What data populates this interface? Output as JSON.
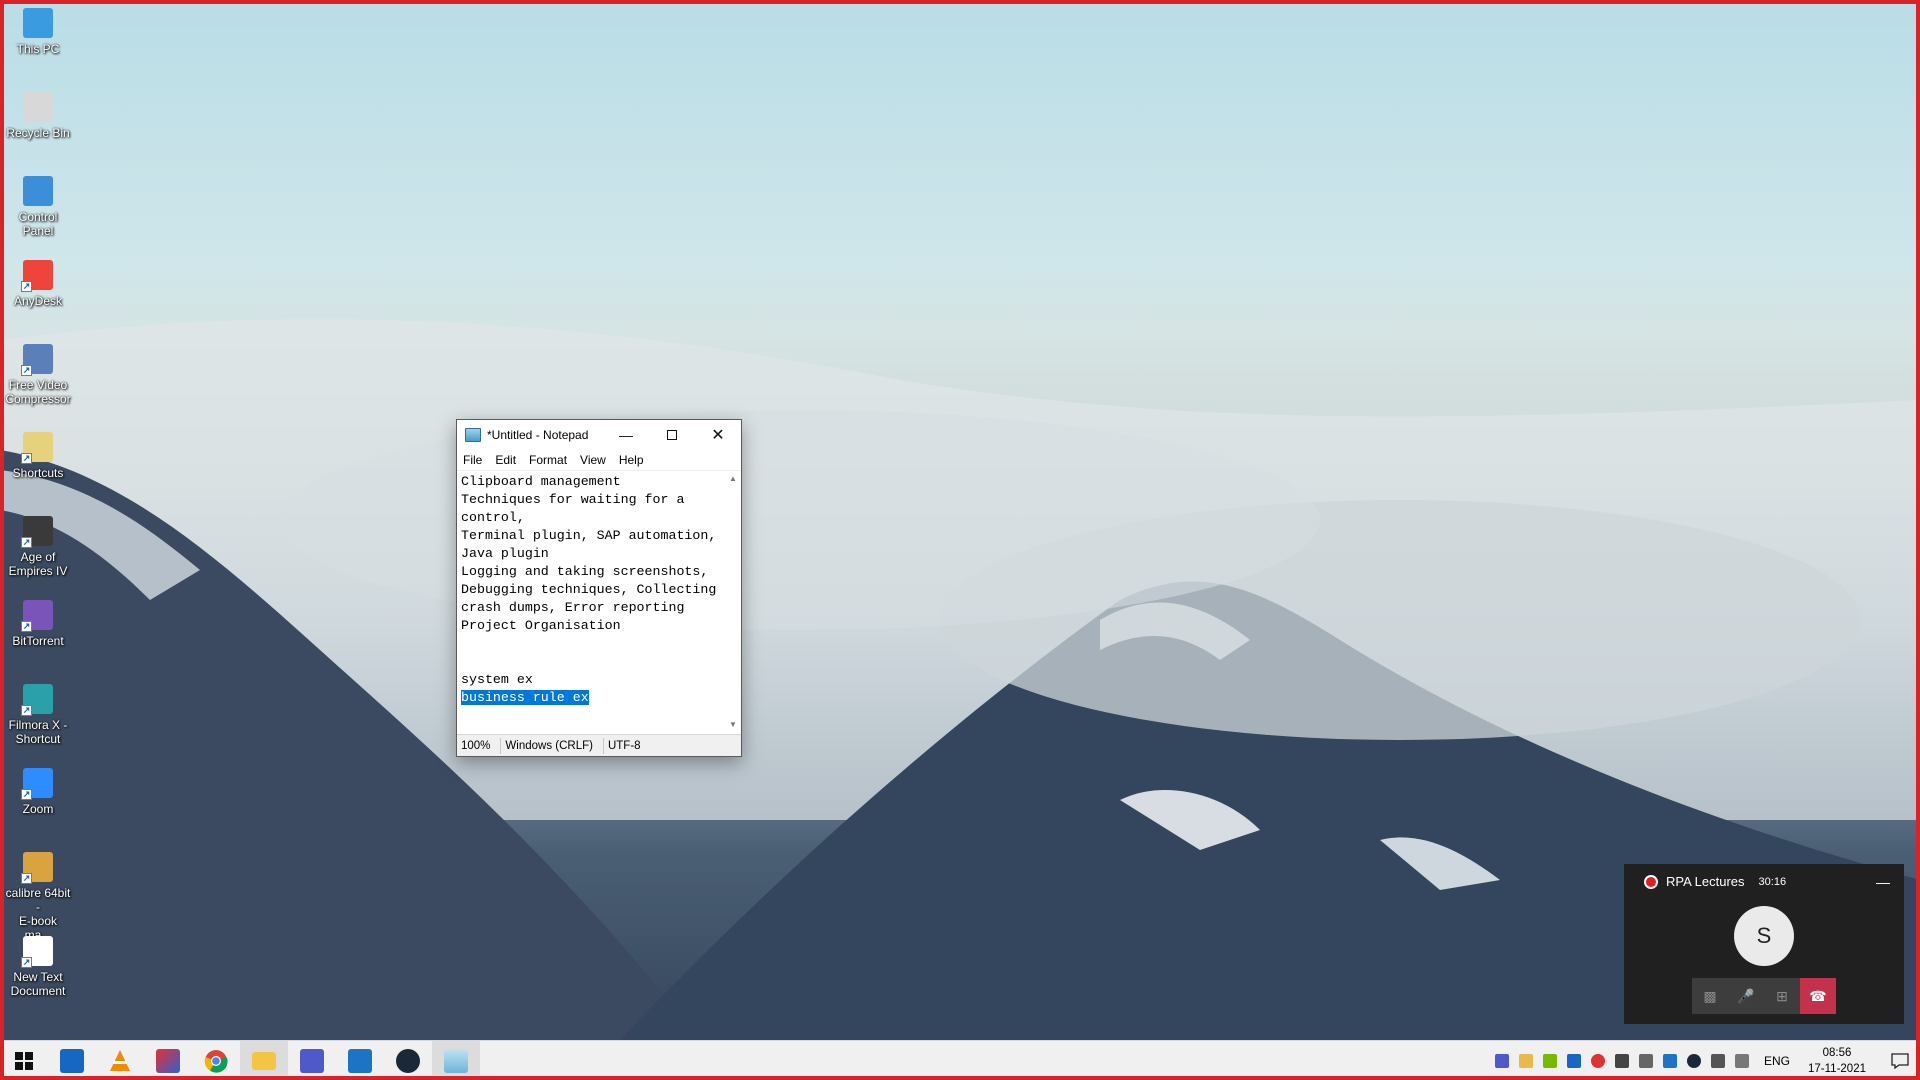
{
  "desktop_icons": [
    {
      "label": "This PC",
      "icon": "this-pc-icon"
    },
    {
      "label": "Recycle Bin",
      "icon": "recycle-bin-icon"
    },
    {
      "label": "Control Panel",
      "icon": "control-panel-icon"
    },
    {
      "label": "AnyDesk",
      "icon": "anydesk-icon"
    },
    {
      "label": "Free Video\nCompressor",
      "icon": "free-video-compressor-icon"
    },
    {
      "label": "Shortcuts",
      "icon": "shortcuts-icon"
    },
    {
      "label": "Age of\nEmpires IV",
      "icon": "age-of-empires-icon"
    },
    {
      "label": "BitTorrent",
      "icon": "bittorrent-icon"
    },
    {
      "label": "Filmora X -\nShortcut",
      "icon": "filmora-icon"
    },
    {
      "label": "Zoom",
      "icon": "zoom-icon"
    },
    {
      "label": "calibre 64bit -\nE-book ma...",
      "icon": "calibre-icon"
    },
    {
      "label": "New Text\nDocument",
      "icon": "text-document-icon"
    }
  ],
  "notepad": {
    "title": "*Untitled - Notepad",
    "menu": [
      "File",
      "Edit",
      "Format",
      "View",
      "Help"
    ],
    "lines": [
      "Clipboard management",
      "Techniques for waiting for a",
      "control,",
      "Terminal plugin, SAP automation,",
      "Java plugin",
      "Logging and taking screenshots,",
      "Debugging techniques, Collecting",
      "crash dumps, Error reporting",
      "Project Organisation",
      "",
      "",
      "system ex"
    ],
    "selected_line": "business rule ex",
    "status": {
      "zoom": "100%",
      "line_ending": "Windows (CRLF)",
      "encoding": "UTF-8"
    }
  },
  "call": {
    "title": "RPA Lectures",
    "duration": "30:16",
    "avatar_initial": "S"
  },
  "taskbar": {
    "apps": [
      "start-icon",
      "outlook-icon",
      "vlc-icon",
      "photo-app-icon",
      "chrome-icon",
      "file-explorer-icon",
      "teams-icon",
      "skype-icon",
      "steam-icon",
      "notepad-icon"
    ],
    "active_app": "notepad-icon",
    "language": "ENG",
    "time": "08:56",
    "date": "17-11-2021"
  }
}
